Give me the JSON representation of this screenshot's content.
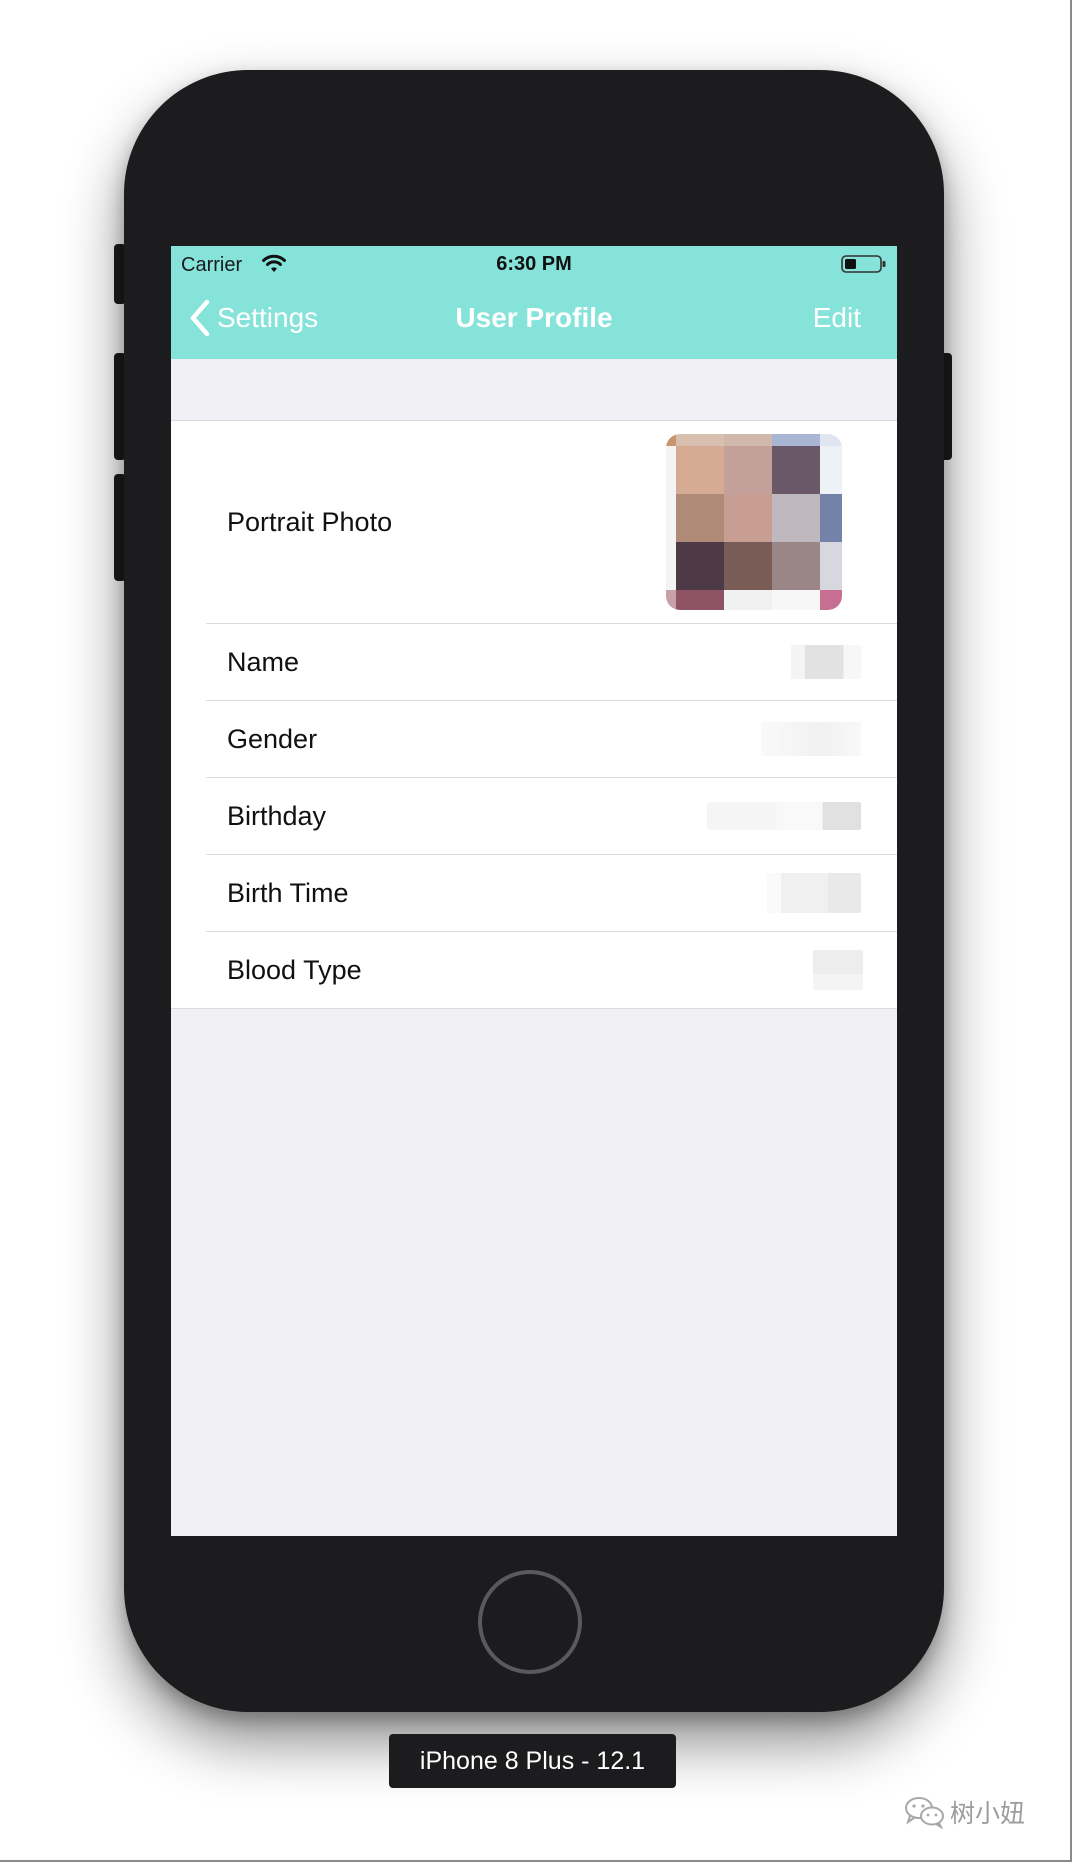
{
  "status_bar": {
    "carrier": "Carrier",
    "time": "6:30 PM"
  },
  "nav": {
    "back_label": "Settings",
    "title": "User Profile",
    "edit_label": "Edit",
    "background_color": "#86e3da"
  },
  "rows": [
    {
      "label": "Portrait Photo"
    },
    {
      "label": "Name"
    },
    {
      "label": "Gender"
    },
    {
      "label": "Birthday"
    },
    {
      "label": "Birth Time"
    },
    {
      "label": "Blood Type"
    }
  ],
  "device_label": "iPhone 8 Plus - 12.1",
  "watermark": "树小妞"
}
